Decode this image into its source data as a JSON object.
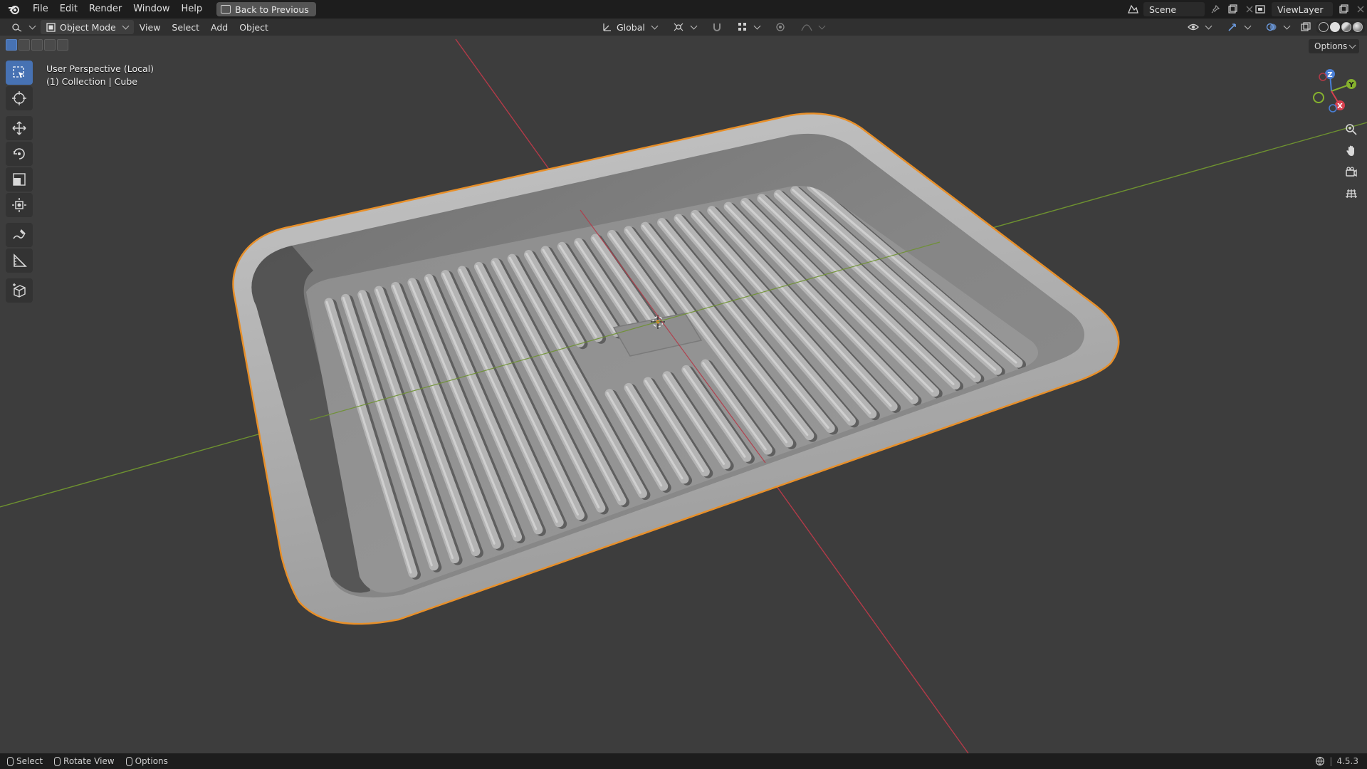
{
  "topbar": {
    "menu": [
      "File",
      "Edit",
      "Render",
      "Window",
      "Help"
    ],
    "back_button": "Back to Previous",
    "scene_name": "Scene",
    "view_layer": "ViewLayer"
  },
  "header": {
    "mode": "Object Mode",
    "menus": [
      "View",
      "Select",
      "Add",
      "Object"
    ],
    "orientation": "Global",
    "options": "Options"
  },
  "viewport": {
    "perspective": "User Perspective (Local)",
    "collection": "(1) Collection | Cube",
    "selection_outline_color": "#e8902a",
    "x_axis_color": "#b33a48",
    "y_axis_color": "#6e9230",
    "gizmo": {
      "z": "Z",
      "y": "Y",
      "x": "X"
    }
  },
  "toolbar": {
    "tools": [
      "select-box",
      "cursor",
      "move",
      "rotate",
      "scale",
      "transform",
      "annotate",
      "measure",
      "add-cube"
    ],
    "active": "select-box"
  },
  "nav_buttons": [
    "zoom-icon",
    "pan-hand-icon",
    "camera-icon",
    "ortho-grid-icon"
  ],
  "statusbar": {
    "select": "Select",
    "rotate_view": "Rotate View",
    "options": "Options",
    "version": "4.5.3"
  }
}
